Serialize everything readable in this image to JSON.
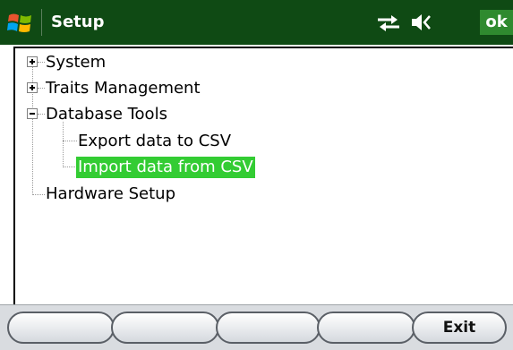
{
  "titlebar": {
    "title": "Setup",
    "ok_label": "ok",
    "icons": [
      "windows-start-icon",
      "connectivity-icon",
      "volume-icon"
    ]
  },
  "tree": {
    "items": [
      {
        "label": "System",
        "expander": "plus"
      },
      {
        "label": "Traits Management",
        "expander": "plus"
      },
      {
        "label": "Database Tools",
        "expander": "minus"
      },
      {
        "label": "Export data to CSV"
      },
      {
        "label": "Import data from CSV",
        "selected": true
      },
      {
        "label": "Hardware Setup"
      }
    ]
  },
  "softkeys": [
    "",
    "",
    "",
    "",
    "Exit"
  ],
  "colors": {
    "titlebar_bg": "#0f4a14",
    "ok_bg": "#2f8a2f",
    "selection": "#33cc33"
  }
}
